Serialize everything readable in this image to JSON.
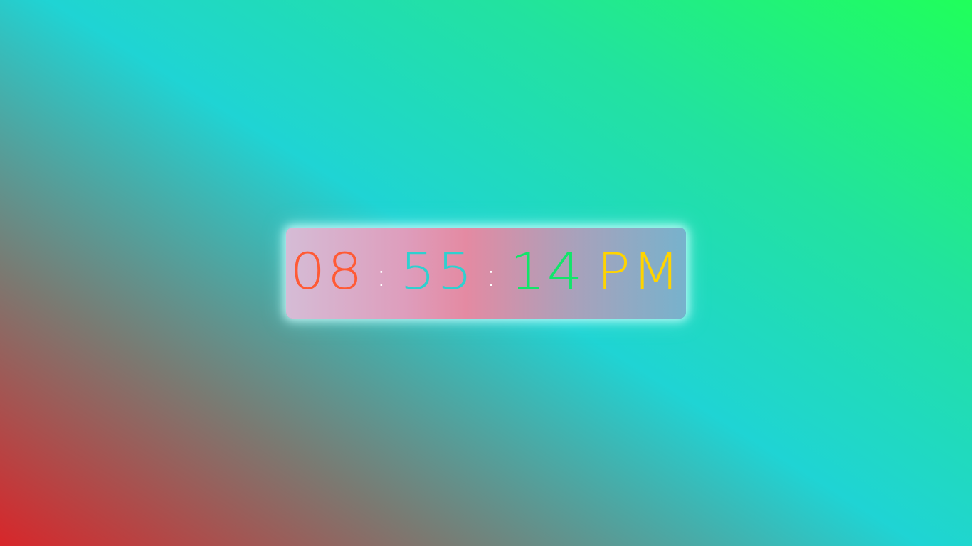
{
  "clock": {
    "hours": "08",
    "minutes": "55",
    "seconds": "14",
    "separator": ":",
    "meridiem": "PM"
  },
  "colors": {
    "hours": "#ff5a35",
    "minutes": "#2fd0cf",
    "seconds": "#12e56a",
    "meridiem": "#ffd400",
    "separator": "#ffffff"
  }
}
